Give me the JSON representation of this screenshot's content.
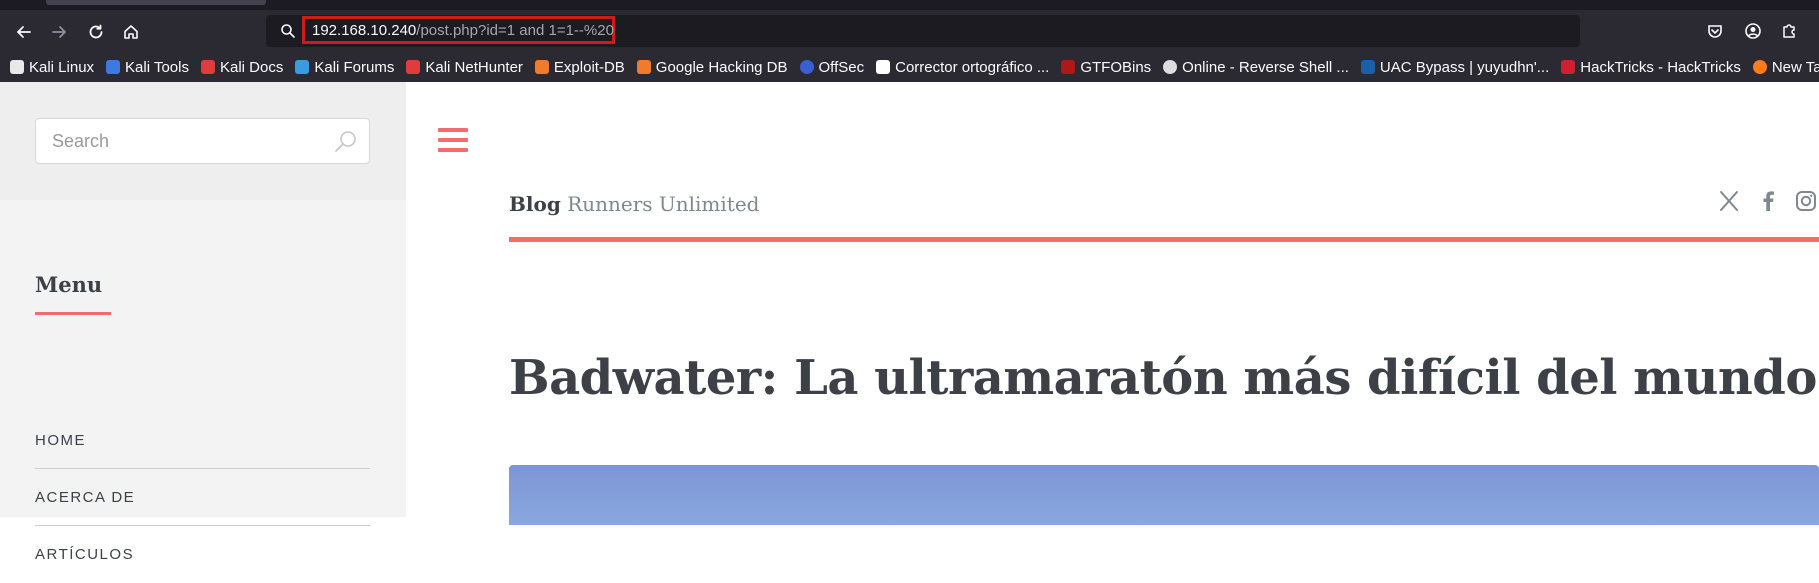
{
  "browser": {
    "url_host": "192.168.10.240",
    "url_path": "/post.php?id=1 and 1=1--%20",
    "bookmarks": [
      {
        "label": "Kali Linux",
        "icon": "kali-dragon-icon",
        "color": "#e8e8e8"
      },
      {
        "label": "Kali Tools",
        "icon": "kali-tools-icon",
        "color": "#3c7ae0"
      },
      {
        "label": "Kali Docs",
        "icon": "kali-docs-icon",
        "color": "#e03c3c"
      },
      {
        "label": "Kali Forums",
        "icon": "kali-forums-icon",
        "color": "#3c9ae0"
      },
      {
        "label": "Kali NetHunter",
        "icon": "nethunter-icon",
        "color": "#e03c3c"
      },
      {
        "label": "Exploit-DB",
        "icon": "exploitdb-icon",
        "color": "#f07b2a"
      },
      {
        "label": "Google Hacking DB",
        "icon": "ghdb-icon",
        "color": "#f07b2a"
      },
      {
        "label": "OffSec",
        "icon": "offsec-icon",
        "color": "#3a5fd0"
      },
      {
        "label": "Corrector ortográfico ...",
        "icon": "corrector-icon",
        "color": "#ffffff"
      },
      {
        "label": "GTFOBins",
        "icon": "gtfobins-icon",
        "color": "#b01818"
      },
      {
        "label": "Online - Reverse Shell ...",
        "icon": "skull-icon",
        "color": "#dddddd"
      },
      {
        "label": "UAC Bypass | yuyudhn'...",
        "icon": "uac-icon",
        "color": "#1a5fa8"
      },
      {
        "label": "HackTricks - HackTricks",
        "icon": "hacktricks-icon",
        "color": "#d02030"
      },
      {
        "label": "New Tab",
        "icon": "firefox-icon",
        "color": "#ff7a1a"
      }
    ]
  },
  "sidebar": {
    "search_placeholder": "Search",
    "menu_title": "Menu",
    "items": [
      "HOME",
      "ACERCA DE",
      "ARTÍCULOS"
    ]
  },
  "header": {
    "blog_label": "Blog",
    "blog_subtitle": "Runners Unlimited"
  },
  "post": {
    "title": "Badwater: La ultramaratón más difícil del mundo"
  },
  "colors": {
    "accent": "#f56a6a",
    "text": "#3d4047",
    "highlight_box": "#d11a1a"
  }
}
